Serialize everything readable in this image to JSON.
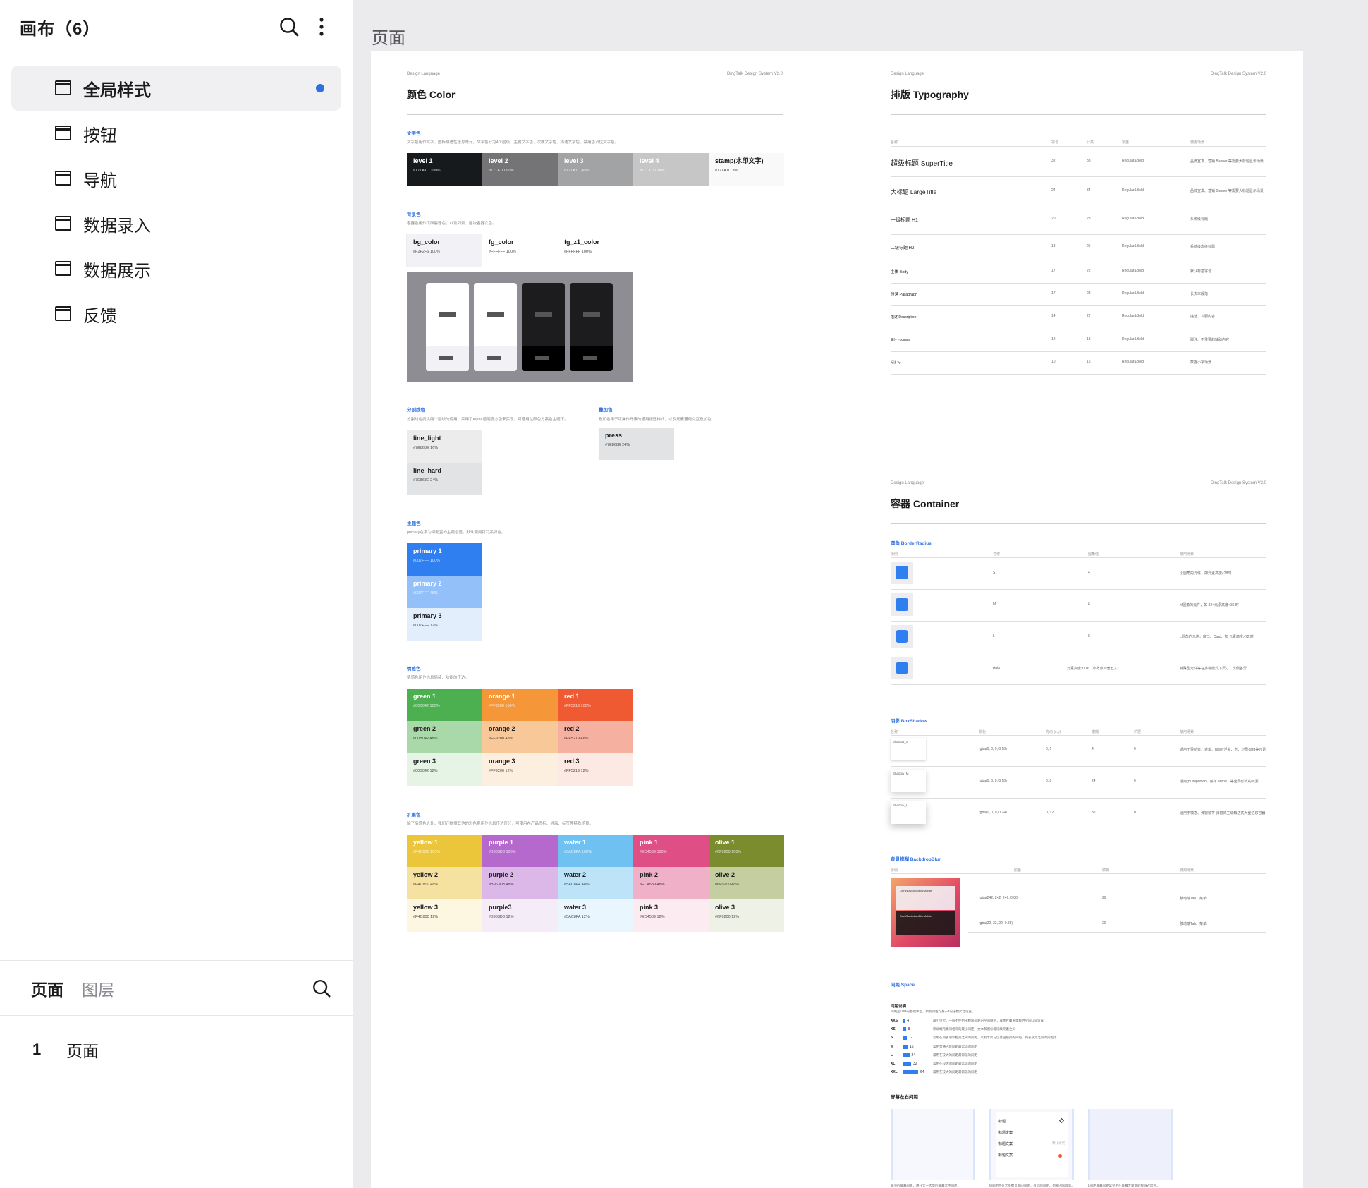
{
  "sidebar": {
    "title": "画布（6）",
    "canvases": [
      {
        "label": "全局样式",
        "active": true
      },
      {
        "label": "按钮"
      },
      {
        "label": "导航"
      },
      {
        "label": "数据录入"
      },
      {
        "label": "数据展示"
      },
      {
        "label": "反馈"
      }
    ],
    "tabs": [
      "页面",
      "图层"
    ],
    "pages": [
      {
        "num": "1",
        "name": "页面"
      }
    ]
  },
  "main": {
    "title": "页面",
    "header_left": "Design Language",
    "header_right": "DingTalk Design System V2.0",
    "color": {
      "title": "颜色 Color",
      "text_label": "文字色",
      "text_desc": "文字色用作文字、图标描述性信息等元，文字色分为4个层级，主要文字色、次要文字色、描述文字色、禁用色占位文字色。",
      "text_swatches": [
        {
          "n": "level 1",
          "v": "#171A1D  100%",
          "bg": "#171a1d",
          "fg": "#ffffff"
        },
        {
          "n": "level 2",
          "v": "#171A1D  60%",
          "bg": "#747476",
          "fg": "#ffffff"
        },
        {
          "n": "level 3",
          "v": "#171A1D  40%",
          "bg": "#a2a3a5",
          "fg": "#ffffff"
        },
        {
          "n": "level 4",
          "v": "#171A1D  24%",
          "bg": "#c6c6c7",
          "fg": "#ffffff"
        },
        {
          "n": "stamp(水印文字)",
          "v": "#171A1D  3%",
          "bg": "#f9f9f9",
          "fg": "#171a1d"
        }
      ],
      "bg_label": "背景色",
      "bg_desc": "容器色用作页面容器色，以及列表、区块容器次色。",
      "bg_swatches": [
        {
          "n": "bg_color",
          "v": "#F2F2F6  100%",
          "bg": "#f2f2f6"
        },
        {
          "n": "fg_color",
          "v": "#FFFFFF  100%",
          "bg": "#ffffff"
        },
        {
          "n": "fg_z1_color",
          "v": "#FFFFFF  100%",
          "bg": "#ffffff"
        }
      ],
      "line_label": "分割线色",
      "line_desc": "分割线色提供两个层级的使用，采用了Alpha透明度方色来实现，可通用在颜色方案色主题下。",
      "line_swatches": [
        {
          "n": "line_light",
          "v": "#7E868E  16%",
          "bg": "#ececed"
        },
        {
          "n": "line_hard",
          "v": "#7E868E  24%",
          "bg": "#e2e3e4"
        }
      ],
      "press_label": "叠加色",
      "press_desc": "叠加色用于可操作元素的通用按压样式，以及元素通用交互叠加色。",
      "press_swatch": {
        "n": "press",
        "v": "#7E868E  24%",
        "bg": "#e2e3e4"
      },
      "primary_label": "主题色",
      "primary_desc": "primary色系为可配置的主题色值，默认使用钉钉品牌色。",
      "primary_swatches": [
        {
          "n": "primary 1",
          "v": "#007FFF  100%",
          "bg": "#2f7ff0",
          "fg": "#ffffff"
        },
        {
          "n": "primary 2",
          "v": "#007FFF  48%",
          "bg": "#94c0fa",
          "fg": "#ffffff"
        },
        {
          "n": "primary 3",
          "v": "#007FFF  12%",
          "bg": "#e3eefc",
          "fg": "#1b1b1d"
        }
      ],
      "status_label": "情感色",
      "status_desc": "情感色用作信息情绪、功能的传达。",
      "status_swatches": [
        [
          {
            "n": "green 1",
            "v": "#00B042  100%",
            "bg": "#4caf50",
            "fg": "#ffffff"
          },
          {
            "n": "orange 1",
            "v": "#FF9200  100%",
            "bg": "#f59638",
            "fg": "#ffffff"
          },
          {
            "n": "red 1",
            "v": "#FF5219  100%",
            "bg": "#f05a33",
            "fg": "#ffffff"
          }
        ],
        [
          {
            "n": "green 2",
            "v": "#00B042  48%",
            "bg": "#a9d9a8",
            "fg": "#1b1b1d"
          },
          {
            "n": "orange 2",
            "v": "#FF9200  48%",
            "bg": "#f9c899",
            "fg": "#1b1b1d"
          },
          {
            "n": "red 2",
            "v": "#FF5219  48%",
            "bg": "#f6b09f",
            "fg": "#1b1b1d"
          }
        ],
        [
          {
            "n": "green 3",
            "v": "#00B042  12%",
            "bg": "#e5f4e5",
            "fg": "#1b1b1d"
          },
          {
            "n": "orange 3",
            "v": "#FF9200  12%",
            "bg": "#fdefe0",
            "fg": "#1b1b1d"
          },
          {
            "n": "red 3",
            "v": "#FF5219  12%",
            "bg": "#fde9e3",
            "fg": "#1b1b1d"
          }
        ]
      ],
      "ext_label": "扩展色",
      "ext_desc": "除了情感色之外，我们还提供其他的彩色系用作信息传达区分，可使用在产品图标、插画、标签等特殊场景。",
      "ext_swatches": [
        [
          {
            "n": "yellow 1",
            "v": "#F4C800  100%",
            "bg": "#ecc63a",
            "fg": "#ffffff"
          },
          {
            "n": "purple 1",
            "v": "#B963D3  100%",
            "bg": "#b569cd",
            "fg": "#ffffff"
          },
          {
            "n": "water 1",
            "v": "#5AC8FA  100%",
            "bg": "#6fc1f2",
            "fg": "#ffffff"
          },
          {
            "n": "pink 1",
            "v": "#EC4589  100%",
            "bg": "#df4f85",
            "fg": "#ffffff"
          },
          {
            "n": "olive 1",
            "v": "#6F9200  100%",
            "bg": "#7b8c2e",
            "fg": "#ffffff"
          }
        ],
        [
          {
            "n": "yellow 2",
            "v": "#F4C800  48%",
            "bg": "#f5e2a0",
            "fg": "#1b1b1d"
          },
          {
            "n": "purple 2",
            "v": "#B963D3  48%",
            "bg": "#dcb8e8",
            "fg": "#1b1b1d"
          },
          {
            "n": "water 2",
            "v": "#5AC8FA  48%",
            "bg": "#bde3f8",
            "fg": "#1b1b1d"
          },
          {
            "n": "pink 2",
            "v": "#EC4589  48%",
            "bg": "#efb0c8",
            "fg": "#1b1b1d"
          },
          {
            "n": "olive 2",
            "v": "#6F9200  48%",
            "bg": "#c5cea0",
            "fg": "#1b1b1d"
          }
        ],
        [
          {
            "n": "yellow 3",
            "v": "#F4C800  12%",
            "bg": "#fdf7e1",
            "fg": "#1b1b1d"
          },
          {
            "n": "purple3",
            "v": "#B963D3  12%",
            "bg": "#f4ecf7",
            "fg": "#1b1b1d"
          },
          {
            "n": "water 3",
            "v": "#5AC8FA  12%",
            "bg": "#eaf6fd",
            "fg": "#1b1b1d"
          },
          {
            "n": "pink 3",
            "v": "#EC4589  12%",
            "bg": "#fcebf1",
            "fg": "#1b1b1d"
          },
          {
            "n": "olive 3",
            "v": "#6F9200  12%",
            "bg": "#eef1e6",
            "fg": "#1b1b1d"
          }
        ]
      ]
    },
    "typography": {
      "title": "排版 Typography",
      "headers": [
        "名称",
        "字号",
        "行高",
        "字重",
        "使用场景"
      ],
      "rows": [
        [
          "超级标题 SuperTitle",
          "32",
          "38",
          "Regular&Bold",
          "品牌宣发、营销 Banner 等需要大标题显示场景"
        ],
        [
          "大标题 LargeTitle",
          "24",
          "34",
          "Regular&Bold",
          "品牌宣发、营销 Banner 等需要大标题显示场景"
        ],
        [
          "一级标题 H1",
          "20",
          "28",
          "Regular&Bold",
          "系统级标题"
        ],
        [
          "二级标题 H2",
          "18",
          "25",
          "Regular&Bold",
          "系统级次级标题"
        ],
        [
          "主体 Body",
          "17",
          "22",
          "Regular&Bold",
          "默认标签字号"
        ],
        [
          "段落 Paragraph",
          "17",
          "28",
          "Regular&Bold",
          "长文本段落"
        ],
        [
          "描述 Description",
          "14",
          "22",
          "Regular&Bold",
          "描述、次要内容"
        ],
        [
          "脚注 Footnote",
          "12",
          "18",
          "Regular&Bold",
          "脚注、不重要的辅助内容"
        ],
        [
          "标注 Tip",
          "10",
          "16",
          "Regular&Bold",
          "数据小字场景"
        ]
      ]
    },
    "container": {
      "title": "容器 Container",
      "radius_label": "圆角 BorderRadius",
      "radius_headers": [
        "示例",
        "名称",
        "圆角值",
        "使用场景"
      ],
      "radius_rows": [
        [
          "S",
          "4",
          "小圆角的元件，如元素高度≤28时"
        ],
        [
          "M",
          "6",
          "M圆角的元件，如 32<元素高度<36 时"
        ],
        [
          "L",
          "8",
          "L圆角的元件，窗口、Card、如 元素高度>72 时"
        ],
        [
          "Auto",
          "元素高度*0.16（小数点四舍五入）",
          "特殊型元件等在多端模式下尺寸、比例各异"
        ]
      ],
      "shadow_label": "阴影 BoxShadow",
      "shadow_headers": [
        "名称",
        "颜色",
        "方向 (x,y)",
        "模糊",
        "扩展",
        "使用场景"
      ],
      "shadow_rows": [
        [
          "Shadow_S",
          "rgba(0, 0, 0, 0.18)",
          "0, 1",
          "4",
          "0",
          "适用于导航条、表单、hover浮窗、卡、小型card等元素"
        ],
        [
          "Shadow_M",
          "rgba(0, 0, 0, 0.18)",
          "0, 8",
          "24",
          "0",
          "适用于Dropdown、菜单 Menu、等全局形式的元素"
        ],
        [
          "Shadow_L",
          "rgba(0, 0, 0, 0.24)",
          "0, 12",
          "32",
          "0",
          "适用于模态、弹窗窗等 弹窗式主动触达式大型信息容器"
        ]
      ],
      "blur_label": "背景模糊 BackdropBlur",
      "blur_headers": [
        "示例",
        "颜色",
        "模糊",
        "使用场景"
      ],
      "blur_rows": [
        [
          "rgba(242, 242, 246, 0.88)",
          "20",
          "移动端Tab、菜单"
        ],
        [
          "rgba(22, 22, 22, 0.88)",
          "20",
          "移动端Tab、菜单"
        ]
      ],
      "blur_preview": [
        "Light/BackdropBlurMobile",
        "Dark/BackdropBlurMobile"
      ],
      "space_label": "间距 Space",
      "space_sub": "间距说明",
      "space_desc": "间距是UI中的基础单位，所有间距均基于4的倍数尺寸设置。",
      "space_rows": [
        {
          "name": "XXS",
          "val": "4",
          "w": 2,
          "desc": "最小单位，一般不使用于模块间距的空间规则，或图片覆盖量级时空间Line设置"
        },
        {
          "name": "XS",
          "val": "8",
          "w": 4,
          "desc": "移动端元素间相邻的最小间距，文本和图标等同级元素之间"
        },
        {
          "name": "S",
          "val": "12",
          "w": 6,
          "desc": "常用在列表项和相关之间的间距，以及卡片与信息层级间的间距，列表或元之间的间距等"
        },
        {
          "name": "M",
          "val": "16",
          "w": 8,
          "desc": "常用普通内容间距最常见的间距"
        },
        {
          "name": "L",
          "val": "24",
          "w": 12,
          "desc": "常用在较大的间距最常见的间距"
        },
        {
          "name": "XL",
          "val": "32",
          "w": 16,
          "desc": "常用在较大的间距最常见的间距"
        },
        {
          "name": "XXL",
          "val": "64",
          "w": 32,
          "desc": "常用在较大的间距最常见的间距"
        }
      ],
      "layout_label": "屏幕左右间距",
      "layout_captions": [
        "最小的屏幕间距，用在大于大型的屏幕元件间距。",
        "M间距用在大多数页面的间距，有页面间距，列表内容等等。",
        "L间距屏幕间距常见用在屏幕大量宽的版域过度区。"
      ],
      "phone_items": [
        "标题",
        "标题文案",
        "标题文案",
        "标题文案"
      ],
      "phone_tag": "默认文案"
    }
  }
}
